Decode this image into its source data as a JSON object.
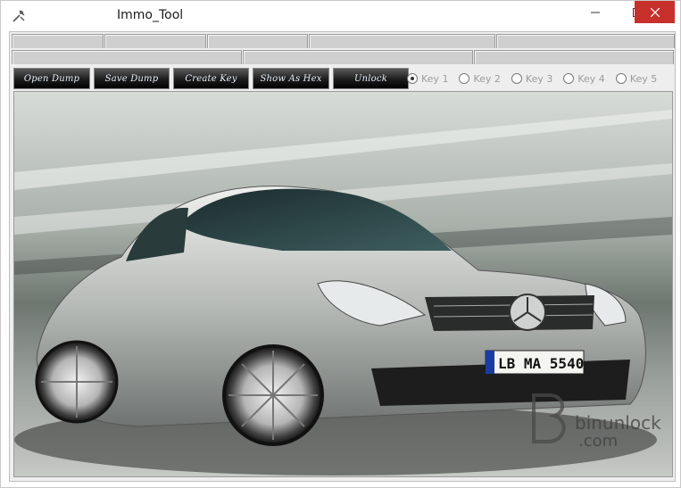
{
  "window": {
    "title": "Immo_Tool",
    "close_color": "#c7302b"
  },
  "icons": {
    "app": "tools-icon",
    "minimize": "minimize-icon",
    "maximize": "maximize-icon",
    "close": "close-icon"
  },
  "toolbar": {
    "buttons": [
      "Open Dump",
      "Save Dump",
      "Create Key",
      "Show As Hex",
      "Unlock"
    ]
  },
  "keys": {
    "options": [
      "Key 1",
      "Key 2",
      "Key 3",
      "Key 4",
      "Key 5"
    ],
    "selected": "Key 1"
  },
  "image": {
    "subject": "silver-sports-car-photo",
    "plate": "LB MA 5540",
    "watermark_line1": "binunlock",
    "watermark_line2": ".com"
  }
}
